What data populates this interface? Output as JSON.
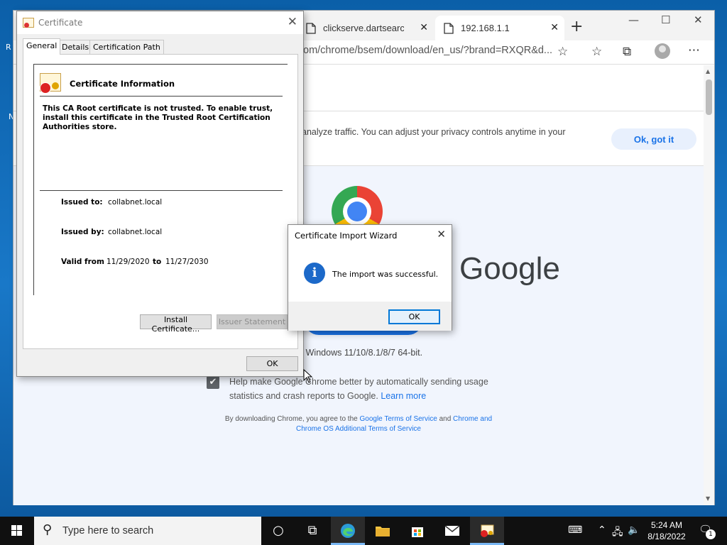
{
  "desktop": {
    "fragment_r": "R",
    "fragment_n": "N"
  },
  "browser": {
    "tabs": [
      {
        "label": "clickserve.dartsearch.net",
        "close": "✕"
      },
      {
        "label": "192.168.1.1",
        "close": "✕"
      }
    ],
    "new_tab": "+",
    "window_controls": {
      "minimize": "—",
      "maximize": "☐",
      "close": "✕"
    },
    "address": "om/chrome/bsem/download/en_us/?brand=RXQR&d...",
    "toolbar_icons": {
      "favorite_add": "☆",
      "favorites": "☆",
      "collections": "⧉",
      "menu": "⋯"
    },
    "page": {
      "privacy_text": "analyze traffic. You can adjust your privacy controls anytime in your",
      "ok_got_it": "Ok, got it",
      "google_word": "Google",
      "os_text": "r Windows 11/10/8.1/8/7 64-bit.",
      "usage_check": "✔",
      "usage_text_1": "Help make Google Chrome better by automatically sending usage statistics and crash reports to Google.",
      "learn_more": "Learn more",
      "terms_prefix": "By downloading Chrome, you agree to the",
      "terms_link1": "Google Terms of Service",
      "terms_and": "and",
      "terms_link2": "Chrome and Chrome OS Additional Terms of Service"
    }
  },
  "cert_dialog": {
    "title": "Certificate",
    "close": "✕",
    "tabs": [
      "General",
      "Details",
      "Certification Path"
    ],
    "heading": "Certificate Information",
    "warning": "This CA Root certificate is not trusted. To enable trust, install this certificate in the Trusted Root Certification Authorities store.",
    "issued_to_label": "Issued to:",
    "issued_to_value": "collabnet.local",
    "issued_by_label": "Issued by:",
    "issued_by_value": "collabnet.local",
    "valid_from_label": "Valid from",
    "valid_from_value": "11/29/2020",
    "valid_to_label": "to",
    "valid_to_value": "11/27/2030",
    "install_button": "Install Certificate...",
    "issuer_button": "Issuer Statement",
    "ok_button": "OK"
  },
  "wizard": {
    "title": "Certificate Import Wizard",
    "close": "✕",
    "info_glyph": "i",
    "message": "The import was successful.",
    "ok_button": "OK"
  },
  "taskbar": {
    "search_placeholder": "Type here to search",
    "time": "5:24 AM",
    "date": "8/18/2022",
    "notification_count": "1"
  }
}
